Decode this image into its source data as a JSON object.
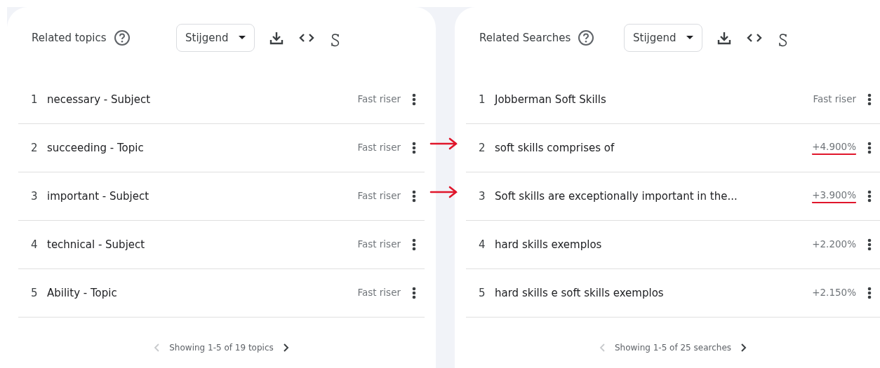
{
  "panels": [
    {
      "title": "Related topics",
      "dropdown": "Stijgend",
      "rows": [
        {
          "rank": "1",
          "label": "necessary - Subject",
          "value": "Fast riser",
          "marked": false
        },
        {
          "rank": "2",
          "label": "succeeding - Topic",
          "value": "Fast riser",
          "marked": false
        },
        {
          "rank": "3",
          "label": "important - Subject",
          "value": "Fast riser",
          "marked": false
        },
        {
          "rank": "4",
          "label": "technical - Subject",
          "value": "Fast riser",
          "marked": false
        },
        {
          "rank": "5",
          "label": "Ability - Topic",
          "value": "Fast riser",
          "marked": false
        }
      ],
      "pagination": "Showing 1-5 of 19 topics",
      "prev_disabled": true
    },
    {
      "title": "Related Searches",
      "dropdown": "Stijgend",
      "rows": [
        {
          "rank": "1",
          "label": "Jobberman Soft Skills",
          "value": "Fast riser",
          "marked": false
        },
        {
          "rank": "2",
          "label": "soft skills comprises of",
          "value": "+4.900%",
          "marked": true
        },
        {
          "rank": "3",
          "label": "Soft skills are exceptionally important in the...",
          "value": "+3.900%",
          "marked": true
        },
        {
          "rank": "4",
          "label": "hard skills exemplos",
          "value": "+2.200%",
          "marked": false
        },
        {
          "rank": "5",
          "label": "hard skills e soft skills exemplos",
          "value": "+2.150%",
          "marked": false
        }
      ],
      "pagination": "Showing 1-5 of 25 searches",
      "prev_disabled": true
    }
  ]
}
